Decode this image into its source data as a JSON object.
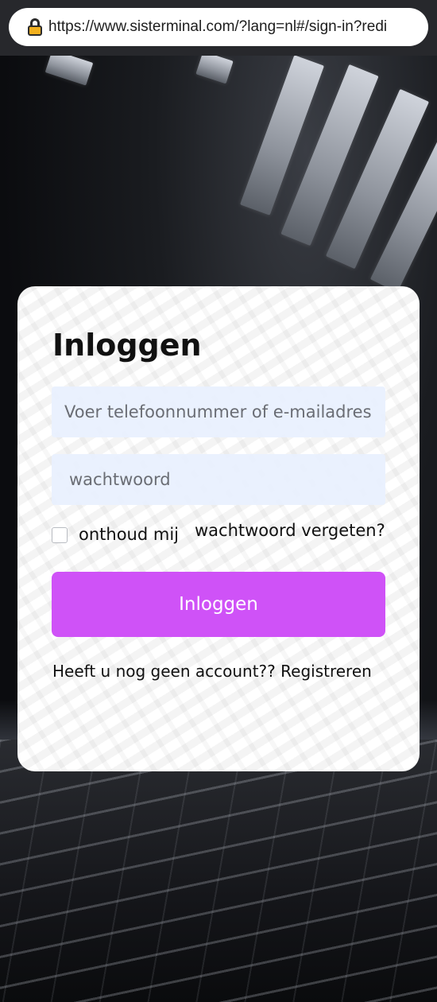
{
  "browser": {
    "url": "https://www.sisterminal.com/?lang=nl#/sign-in?redi"
  },
  "login": {
    "title": "Inloggen",
    "username_placeholder": "Voer telefoonnummer of e-mailadres in",
    "password_placeholder": "wachtwoord",
    "remember_label": "onthoud mij",
    "forgot_label": "wachtwoord vergeten?",
    "submit_label": "Inloggen",
    "no_account_text": "Heeft u nog geen account??",
    "register_label": "Registreren"
  },
  "colors": {
    "accent": "#cf52f7",
    "input_bg": "#e8f0fe"
  },
  "icons": {
    "lock": "lock-icon"
  }
}
